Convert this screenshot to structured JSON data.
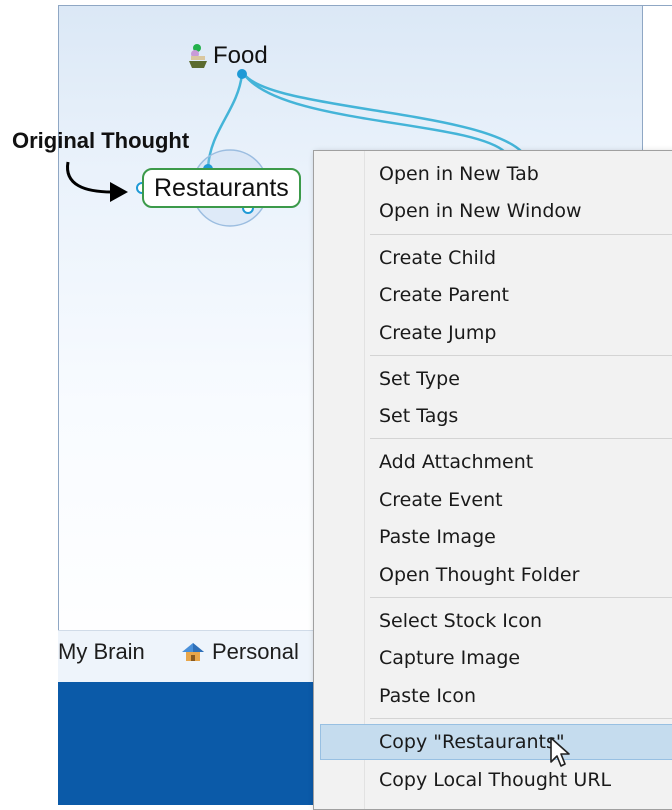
{
  "annotation": {
    "label": "Original Thought"
  },
  "thoughts": {
    "parent": {
      "label": "Food",
      "icon": "food-bowl-icon"
    },
    "selected": {
      "label": "Restaurants"
    }
  },
  "bottom_tabs": [
    {
      "label": "My Brain"
    },
    {
      "label": "Personal",
      "icon": "home-icon"
    }
  ],
  "context_menu": {
    "groups": [
      [
        "Open in New Tab",
        "Open in New Window"
      ],
      [
        "Create Child",
        "Create Parent",
        "Create Jump"
      ],
      [
        "Set Type",
        "Set Tags"
      ],
      [
        "Add Attachment",
        "Create Event",
        "Paste Image",
        "Open Thought Folder"
      ],
      [
        "Select Stock Icon",
        "Capture Image",
        "Paste Icon"
      ],
      [
        "Copy \"Restaurants\"",
        "Copy Local Thought URL"
      ]
    ],
    "highlighted": "Copy \"Restaurants\""
  },
  "colors": {
    "link_line": "#44b4d8",
    "node_border": "#3c9a4a",
    "menu_highlight": "#c5dcee",
    "taskbar": "#0b5aa8"
  }
}
